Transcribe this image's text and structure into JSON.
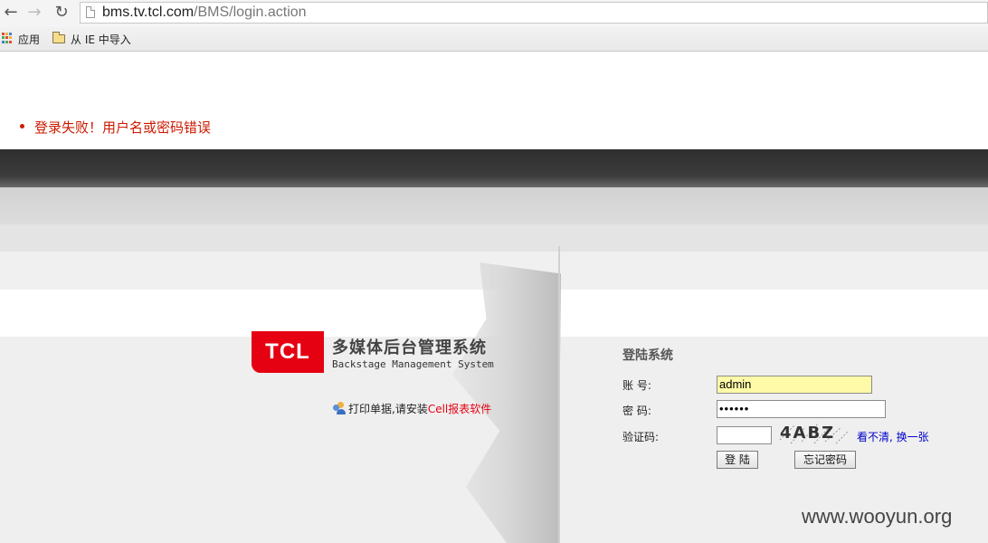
{
  "browser": {
    "url_host": "bms.tv.tcl.com",
    "url_path": "/BMS/login.action",
    "bookmarks": [
      "应用",
      "从 IE 中导入"
    ]
  },
  "error_message": "登录失败！用户名或密码错误",
  "brand": {
    "logo_text": "TCL",
    "system_title": "多媒体后台管理系统",
    "system_subtitle": "Backstage Management System",
    "accent_color": "#e50012"
  },
  "print_note": {
    "text": "打印单据,请安装",
    "link": "Cell报表软件"
  },
  "login": {
    "title": "登陆系统",
    "username_label": "账  号:",
    "username_value": "admin",
    "password_label": "密  码:",
    "password_value": "••••••",
    "captcha_label": "验证码:",
    "captcha_value": "",
    "captcha_text": "4ABZ",
    "refresh_link": "看不清, 换一张",
    "login_button": "登 陆",
    "forgot_button": "忘记密码"
  },
  "watermark": "www.wooyun.org"
}
